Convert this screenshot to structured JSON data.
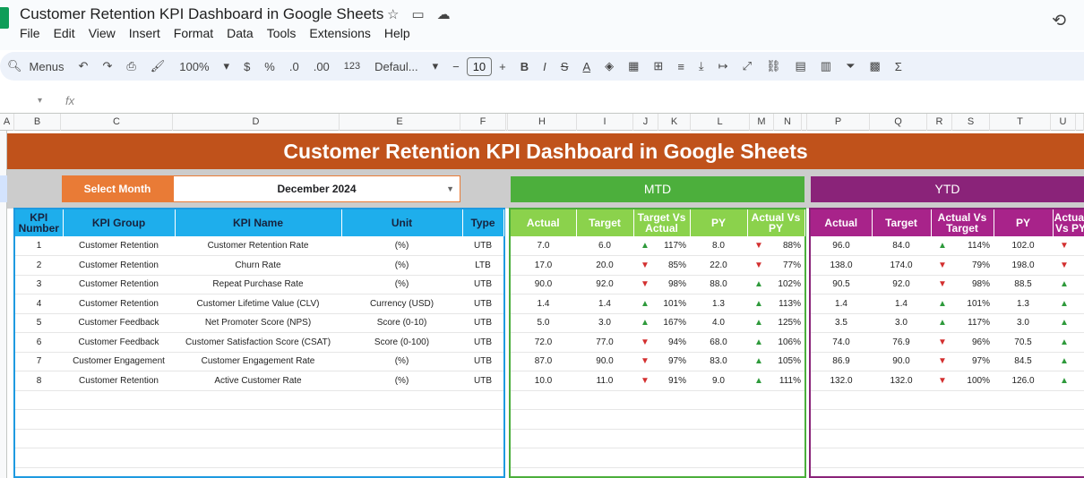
{
  "app": {
    "doc_title": "Customer Retention KPI Dashboard in Google Sheets",
    "menu": [
      "File",
      "Edit",
      "View",
      "Insert",
      "Format",
      "Data",
      "Tools",
      "Extensions",
      "Help"
    ]
  },
  "toolbar": {
    "menus_label": "Menus",
    "zoom": "100%",
    "currency": "$",
    "percent": "%",
    "dec_decrease": ".0",
    "dec_increase": ".00",
    "number_format": "123",
    "font": "Defaul...",
    "font_size": "10",
    "bold": "B",
    "italic": "I",
    "strike": "S",
    "text_color": "A"
  },
  "formula": {
    "fx": "fx",
    "cell_ref": ""
  },
  "columns": [
    "A",
    "B",
    "C",
    "D",
    "E",
    "F",
    "H",
    "I",
    "J",
    "K",
    "L",
    "M",
    "N",
    "P",
    "Q",
    "R",
    "S",
    "T",
    "U"
  ],
  "dashboard": {
    "title": "Customer Retention KPI Dashboard in Google Sheets",
    "select_month_label": "Select Month",
    "selected_month": "December 2024",
    "mtd_label": "MTD",
    "ytd_label": "YTD",
    "left_headers": [
      "KPI Number",
      "KPI Group",
      "KPI Name",
      "Unit",
      "Type"
    ],
    "mtd_headers": [
      "Actual",
      "Target",
      "Target Vs Actual",
      "PY",
      "Actual Vs PY"
    ],
    "ytd_headers": [
      "Actual",
      "Target",
      "Actual Vs Target",
      "PY",
      "Actual Vs PY"
    ],
    "rows": [
      {
        "num": "1",
        "group": "Customer Retention",
        "name": "Customer Retention Rate",
        "unit": "(%)",
        "type": "UTB",
        "mtd_actual": "7.0",
        "mtd_target": "6.0",
        "mtd_tva_dir": "up",
        "mtd_tva": "117%",
        "mtd_py": "8.0",
        "mtd_avp_dir": "down",
        "mtd_avp": "88%",
        "ytd_actual": "96.0",
        "ytd_target": "84.0",
        "ytd_avt_dir": "up",
        "ytd_avt": "114%",
        "ytd_py": "102.0",
        "ytd_avp_dir": "down"
      },
      {
        "num": "2",
        "group": "Customer Retention",
        "name": "Churn Rate",
        "unit": "(%)",
        "type": "LTB",
        "mtd_actual": "17.0",
        "mtd_target": "20.0",
        "mtd_tva_dir": "down",
        "mtd_tva": "85%",
        "mtd_py": "22.0",
        "mtd_avp_dir": "down",
        "mtd_avp": "77%",
        "ytd_actual": "138.0",
        "ytd_target": "174.0",
        "ytd_avt_dir": "down",
        "ytd_avt": "79%",
        "ytd_py": "198.0",
        "ytd_avp_dir": "down"
      },
      {
        "num": "3",
        "group": "Customer Retention",
        "name": "Repeat Purchase Rate",
        "unit": "(%)",
        "type": "UTB",
        "mtd_actual": "90.0",
        "mtd_target": "92.0",
        "mtd_tva_dir": "down",
        "mtd_tva": "98%",
        "mtd_py": "88.0",
        "mtd_avp_dir": "up",
        "mtd_avp": "102%",
        "ytd_actual": "90.5",
        "ytd_target": "92.0",
        "ytd_avt_dir": "down",
        "ytd_avt": "98%",
        "ytd_py": "88.5",
        "ytd_avp_dir": "up"
      },
      {
        "num": "4",
        "group": "Customer Retention",
        "name": "Customer Lifetime Value (CLV)",
        "unit": "Currency (USD)",
        "type": "UTB",
        "mtd_actual": "1.4",
        "mtd_target": "1.4",
        "mtd_tva_dir": "up",
        "mtd_tva": "101%",
        "mtd_py": "1.3",
        "mtd_avp_dir": "up",
        "mtd_avp": "113%",
        "ytd_actual": "1.4",
        "ytd_target": "1.4",
        "ytd_avt_dir": "up",
        "ytd_avt": "101%",
        "ytd_py": "1.3",
        "ytd_avp_dir": "up"
      },
      {
        "num": "5",
        "group": "Customer Feedback",
        "name": "Net Promoter Score (NPS)",
        "unit": "Score (0-10)",
        "type": "UTB",
        "mtd_actual": "5.0",
        "mtd_target": "3.0",
        "mtd_tva_dir": "up",
        "mtd_tva": "167%",
        "mtd_py": "4.0",
        "mtd_avp_dir": "up",
        "mtd_avp": "125%",
        "ytd_actual": "3.5",
        "ytd_target": "3.0",
        "ytd_avt_dir": "up",
        "ytd_avt": "117%",
        "ytd_py": "3.0",
        "ytd_avp_dir": "up"
      },
      {
        "num": "6",
        "group": "Customer Feedback",
        "name": "Customer Satisfaction Score (CSAT)",
        "unit": "Score (0-100)",
        "type": "UTB",
        "mtd_actual": "72.0",
        "mtd_target": "77.0",
        "mtd_tva_dir": "down",
        "mtd_tva": "94%",
        "mtd_py": "68.0",
        "mtd_avp_dir": "up",
        "mtd_avp": "106%",
        "ytd_actual": "74.0",
        "ytd_target": "76.9",
        "ytd_avt_dir": "down",
        "ytd_avt": "96%",
        "ytd_py": "70.5",
        "ytd_avp_dir": "up"
      },
      {
        "num": "7",
        "group": "Customer Engagement",
        "name": "Customer Engagement Rate",
        "unit": "(%)",
        "type": "UTB",
        "mtd_actual": "87.0",
        "mtd_target": "90.0",
        "mtd_tva_dir": "down",
        "mtd_tva": "97%",
        "mtd_py": "83.0",
        "mtd_avp_dir": "up",
        "mtd_avp": "105%",
        "ytd_actual": "86.9",
        "ytd_target": "90.0",
        "ytd_avt_dir": "down",
        "ytd_avt": "97%",
        "ytd_py": "84.5",
        "ytd_avp_dir": "up"
      },
      {
        "num": "8",
        "group": "Customer Retention",
        "name": "Active Customer Rate",
        "unit": "(%)",
        "type": "UTB",
        "mtd_actual": "10.0",
        "mtd_target": "11.0",
        "mtd_tva_dir": "down",
        "mtd_tva": "91%",
        "mtd_py": "9.0",
        "mtd_avp_dir": "up",
        "mtd_avp": "111%",
        "ytd_actual": "132.0",
        "ytd_target": "132.0",
        "ytd_avt_dir": "down",
        "ytd_avt": "100%",
        "ytd_py": "126.0",
        "ytd_avp_dir": "up"
      }
    ]
  },
  "colors": {
    "banner": "#c0521b",
    "select": "#e97b36",
    "mtd": "#4caf3c",
    "ytd": "#8a2379",
    "left_header": "#1eaeec",
    "up": "#2e9a3b",
    "down": "#d32f2f"
  }
}
